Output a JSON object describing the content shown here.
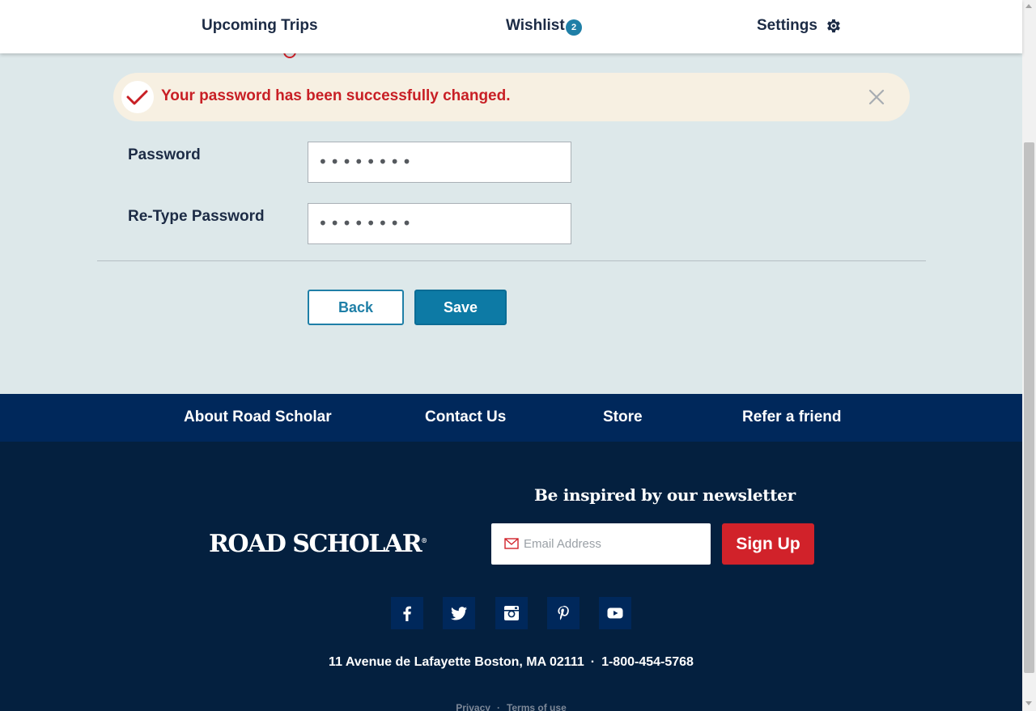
{
  "nav": {
    "upcoming_trips": "Upcoming Trips",
    "wishlist": "Wishlist",
    "wishlist_count": "2",
    "settings": "Settings"
  },
  "alert": {
    "message": "Your password has been successfully changed."
  },
  "form": {
    "password_label": "Password",
    "password_value": "••••••••",
    "retype_label": "Re-Type Password",
    "retype_value": "••••••••",
    "back_label": "Back",
    "save_label": "Save"
  },
  "footer_links": {
    "about": "About Road Scholar",
    "contact": "Contact Us",
    "store": "Store",
    "refer": "Refer a friend"
  },
  "footer": {
    "logo_text": "ROAD SCHOLAR",
    "newsletter_title": "Be inspired by our newsletter",
    "email_placeholder": "Email Address",
    "signup_label": "Sign Up",
    "address": "11 Avenue de Lafayette Boston, MA 02111",
    "separator": "·",
    "phone": "1-800-454-5768",
    "privacy": "Privacy",
    "terms": "Terms of use"
  },
  "colors": {
    "brand_navy": "#04203f",
    "footer_bar": "#00285b",
    "accent_blue": "#0d7aa5",
    "accent_red": "#d1222a",
    "alert_bg": "#f7f0e2",
    "page_bg": "#dde8ea"
  },
  "icons": {
    "settings": "gear-icon",
    "alert_status": "checkmark-icon",
    "alert_dismiss": "close-icon",
    "email": "mail-icon",
    "social": [
      "facebook-icon",
      "twitter-icon",
      "instagram-icon",
      "pinterest-icon",
      "youtube-icon"
    ]
  }
}
